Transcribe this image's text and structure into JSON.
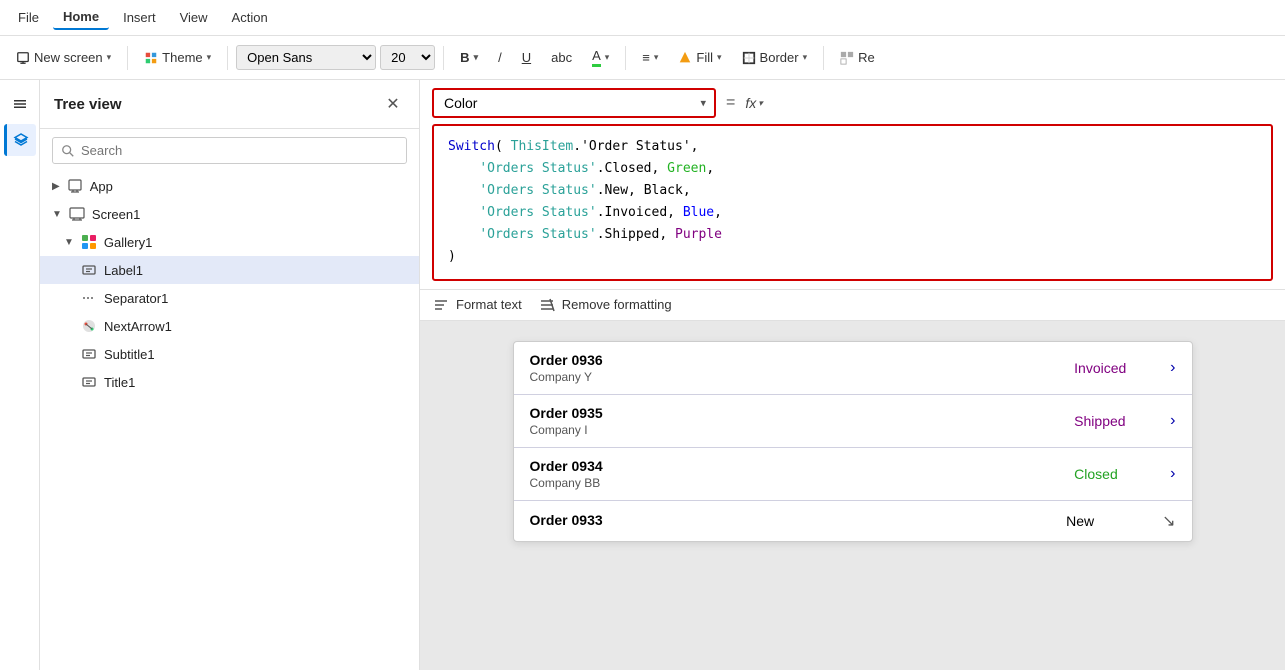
{
  "menu": {
    "items": [
      {
        "label": "File",
        "active": false
      },
      {
        "label": "Home",
        "active": true
      },
      {
        "label": "Insert",
        "active": false
      },
      {
        "label": "View",
        "active": false
      },
      {
        "label": "Action",
        "active": false
      }
    ]
  },
  "toolbar": {
    "new_screen_label": "New screen",
    "theme_label": "Theme",
    "font_value": "Open Sans",
    "font_size_value": "20",
    "bold_label": "B",
    "italic_label": "/",
    "underline_label": "U",
    "strikethrough_label": "abc",
    "font_color_label": "A",
    "align_label": "≡",
    "fill_label": "Fill",
    "border_label": "Border",
    "reorder_label": "Re"
  },
  "formula_bar": {
    "property_label": "Color",
    "equals": "=",
    "fx_label": "fx",
    "formula_lines": [
      "Switch( ThisItem.'Order Status',",
      "    'Orders Status'.Closed, Green,",
      "    'Orders Status'.New, Black,",
      "    'Orders Status'.Invoiced, Blue,",
      "    'Orders Status'.Shipped, Purple",
      ")"
    ]
  },
  "tree_view": {
    "title": "Tree view",
    "search_placeholder": "Search",
    "items": [
      {
        "label": "App",
        "indent": 0,
        "icon": "app",
        "expanded": false
      },
      {
        "label": "Screen1",
        "indent": 0,
        "icon": "screen",
        "expanded": true
      },
      {
        "label": "Gallery1",
        "indent": 1,
        "icon": "gallery",
        "expanded": true
      },
      {
        "label": "Label1",
        "indent": 2,
        "icon": "label",
        "selected": true
      },
      {
        "label": "Separator1",
        "indent": 2,
        "icon": "separator"
      },
      {
        "label": "NextArrow1",
        "indent": 2,
        "icon": "nextarrow"
      },
      {
        "label": "Subtitle1",
        "indent": 2,
        "icon": "label"
      },
      {
        "label": "Title1",
        "indent": 2,
        "icon": "label"
      }
    ]
  },
  "format_bar": {
    "format_text_label": "Format text",
    "remove_formatting_label": "Remove formatting"
  },
  "gallery": {
    "rows": [
      {
        "order": "Order 0936",
        "company": "Company Y",
        "status": "Invoiced",
        "status_type": "invoiced"
      },
      {
        "order": "Order 0935",
        "company": "Company I",
        "status": "Shipped",
        "status_type": "shipped"
      },
      {
        "order": "Order 0934",
        "company": "Company BB",
        "status": "Closed",
        "status_type": "closed"
      },
      {
        "order": "Order 0933",
        "company": "",
        "status": "New",
        "status_type": "new"
      }
    ]
  },
  "colors": {
    "accent_red": "#d00000",
    "accent_blue": "#0078d4",
    "status_invoiced": "#800080",
    "status_shipped": "#800080",
    "status_closed": "#22a222",
    "status_new": "#000000"
  }
}
